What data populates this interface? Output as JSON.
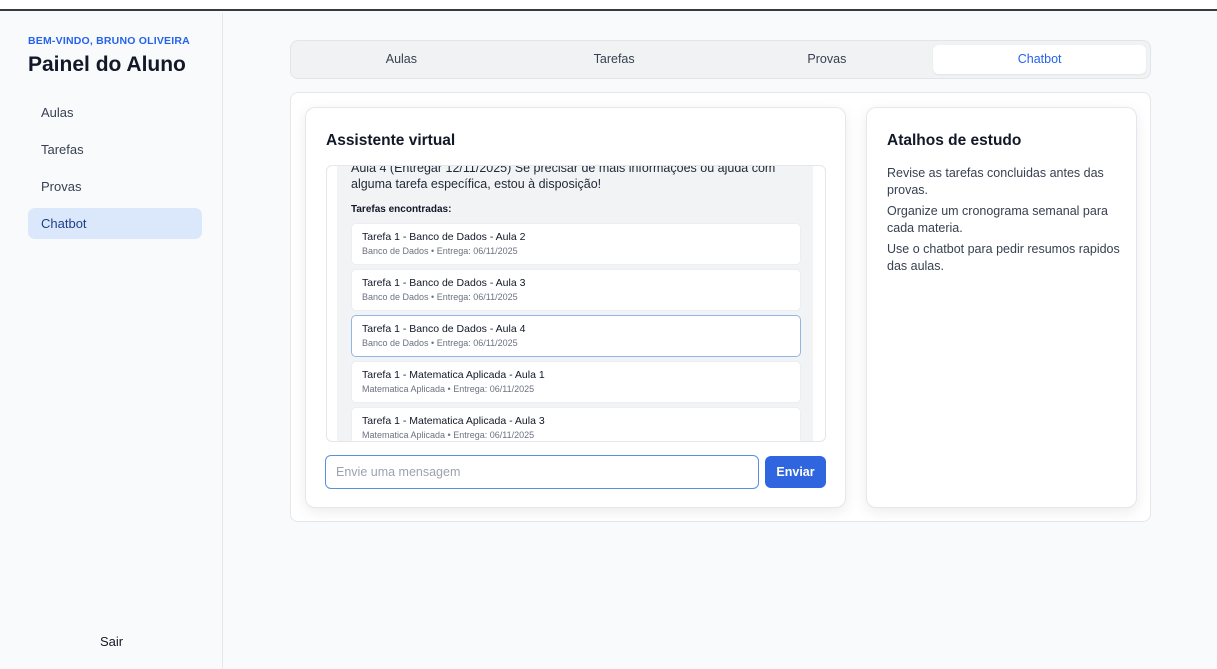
{
  "sidebar": {
    "welcome": "BEM-VINDO, BRUNO OLIVEIRA",
    "title": "Painel do Aluno",
    "items": [
      {
        "label": "Aulas"
      },
      {
        "label": "Tarefas"
      },
      {
        "label": "Provas"
      },
      {
        "label": "Chatbot"
      }
    ],
    "active_index": 3,
    "logout": "Sair"
  },
  "tabs": [
    {
      "label": "Aulas"
    },
    {
      "label": "Tarefas"
    },
    {
      "label": "Provas"
    },
    {
      "label": "Chatbot"
    }
  ],
  "chat": {
    "title": "Assistente virtual",
    "message_text": "Aula 4 (Entregar 12/11/2025) Se precisar de mais informações ou ajuda com alguma tarefa específica, estou à disposição!",
    "tasks_heading": "Tarefas encontradas:",
    "tasks": [
      {
        "name": "Tarefa 1 - Banco de Dados - Aula 2",
        "meta": "Banco de Dados • Entrega: 06/11/2025"
      },
      {
        "name": "Tarefa 1 - Banco de Dados - Aula 3",
        "meta": "Banco de Dados • Entrega: 06/11/2025"
      },
      {
        "name": "Tarefa 1 - Banco de Dados - Aula 4",
        "meta": "Banco de Dados • Entrega: 06/11/2025"
      },
      {
        "name": "Tarefa 1 - Matematica Aplicada - Aula 1",
        "meta": "Matematica Aplicada • Entrega: 06/11/2025"
      },
      {
        "name": "Tarefa 1 - Matematica Aplicada - Aula 3",
        "meta": "Matematica Aplicada • Entrega: 06/11/2025"
      }
    ],
    "input_value": "",
    "input_placeholder": "Envie uma mensagem",
    "send_label": "Enviar"
  },
  "tips": {
    "title": "Atalhos de estudo",
    "items": [
      "Revise as tarefas concluidas antes das provas.",
      "Organize um cronograma semanal para cada materia.",
      "Use o chatbot para pedir resumos rapidos das aulas."
    ]
  },
  "colors": {
    "accent": "#2563eb",
    "active_nav_bg": "#dbe7fb",
    "send_button": "#2f66df"
  }
}
